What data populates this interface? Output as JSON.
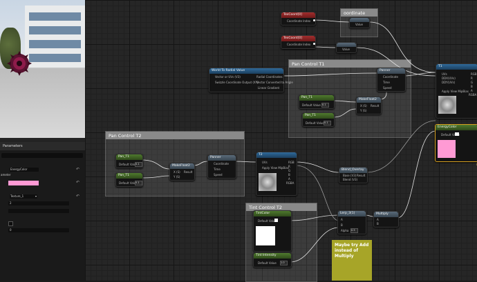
{
  "details": {
    "title": "Parameters",
    "param_label": "ameter",
    "energy_color": "EnergyColor",
    "texture": "Texture_1",
    "value_2": "2",
    "value_0": "0"
  },
  "comments": {
    "coordinate": "oordinate",
    "pan1": "Pan Control T1",
    "pan2": "Pan Control T2",
    "tint2": "Tint Control T2"
  },
  "nodes": {
    "texcoord": "TexCoord[0]",
    "coordinate_index": "Coordinate Index",
    "value": "Value",
    "world_to_radial": "World To Radial Value",
    "vector_xyz": "Vector or UVs (V3)",
    "radial_coords": "Radial Coordinates",
    "swizzle": "Swizzle Coordinate Output (XY)",
    "vector_angle": "Vector Converted to Angle",
    "linear_gradient": "Linear Gradient",
    "panner": "Panner",
    "coordinate": "Coordinate",
    "time": "Time",
    "speed": "Speed",
    "pan_t1": "Pan_T1",
    "default_value": "Default Value",
    "make_float2": "MakeFloat2",
    "x": "X (S)",
    "y": "Y (S)",
    "result": "Result",
    "t1": "T1",
    "uvs": "UVs",
    "ddx": "DDX(UVs)",
    "ddy": "DDY(UVs)",
    "apply_mip": "Apply View MipBias",
    "rgb": "RGB",
    "r": "R",
    "g": "G",
    "b": "B",
    "a": "A",
    "rgba": "RGBA",
    "energy_color": "EnergyColor",
    "tint_color": "TintColor",
    "tint_intensity": "Tint Intensity",
    "blend_overlay": "Blend_Overlay",
    "base": "Base (V3)",
    "blend": "Blend (V3)",
    "lerp": "Lerp_3(1)",
    "alpha": "Alpha",
    "multiply": "Multiply",
    "t2": "T2",
    "v1": "1.0",
    "v01": "0.1",
    "v05": "0.5"
  },
  "note_text": "Maybe try Add instead of Multiply"
}
